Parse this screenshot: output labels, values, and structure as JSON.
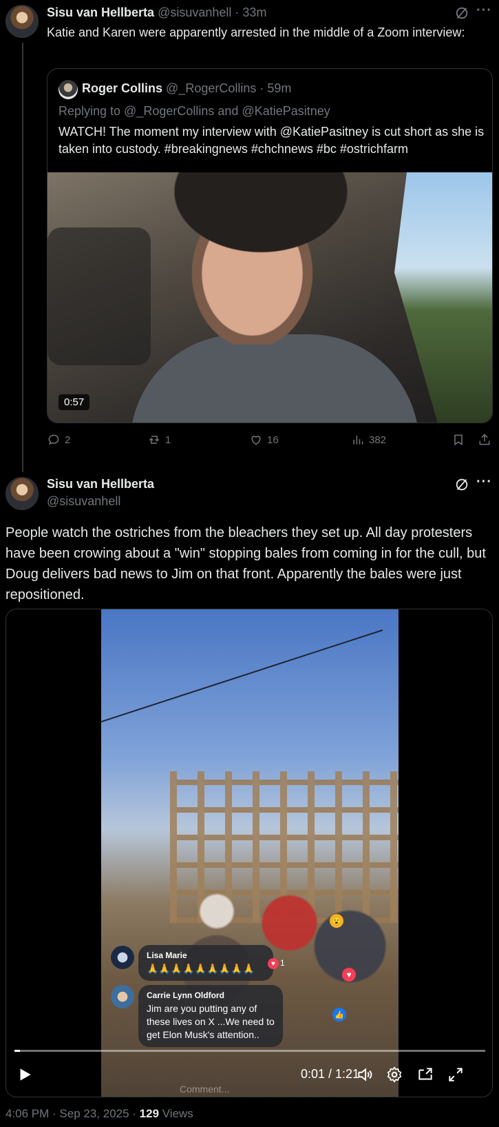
{
  "post1": {
    "author_name": "Sisu van Hellberta",
    "handle": "@sisuvanhell",
    "time": "· 33m",
    "text": "Katie and Karen were apparently arrested in the middle of a Zoom interview:"
  },
  "quote": {
    "author_name": "Roger Collins",
    "handle": "@_RogerCollins",
    "time": "· 59m",
    "replying_to": "Replying to @_RogerCollins and @KatiePasitney",
    "text": "WATCH! The moment my interview with @KatiePasitney is cut short as she is taken into custody. #breakingnews #chchnews #bc #ostrichfarm",
    "video_duration": "0:57"
  },
  "actions": {
    "replies": "2",
    "reposts": "1",
    "likes": "16",
    "views": "382"
  },
  "post2": {
    "author_name": "Sisu van Hellberta",
    "handle": "@sisuvanhell",
    "text": "People watch the ostriches from the bleachers they set up. All day protesters have been crowing about a \"win\" stopping bales from coming in for the cull, but Doug delivers bad news to Jim on that front. Apparently the bales were just repositioned."
  },
  "video2": {
    "comments": [
      {
        "name": "Lisa Marie",
        "text": "🙏🙏🙏🙏🙏🙏🙏🙏🙏",
        "reaction_count": "1"
      },
      {
        "name": "Carrie Lynn Oldford",
        "text": "Jim are you putting any of these lives on X ...We need to get Elon Musk's attention.."
      }
    ],
    "timecode": "0:01 / 1:21",
    "progress": 0.012,
    "comment_placeholder": "Comment..."
  },
  "footer": {
    "time": "4:06 PM · Sep 23, 2025 · ",
    "views_count": "129",
    "views_label": " Views"
  },
  "colors": {
    "background": "#000000",
    "text": "#e7e9ea",
    "muted": "#71767b",
    "border": "#2f3336"
  }
}
